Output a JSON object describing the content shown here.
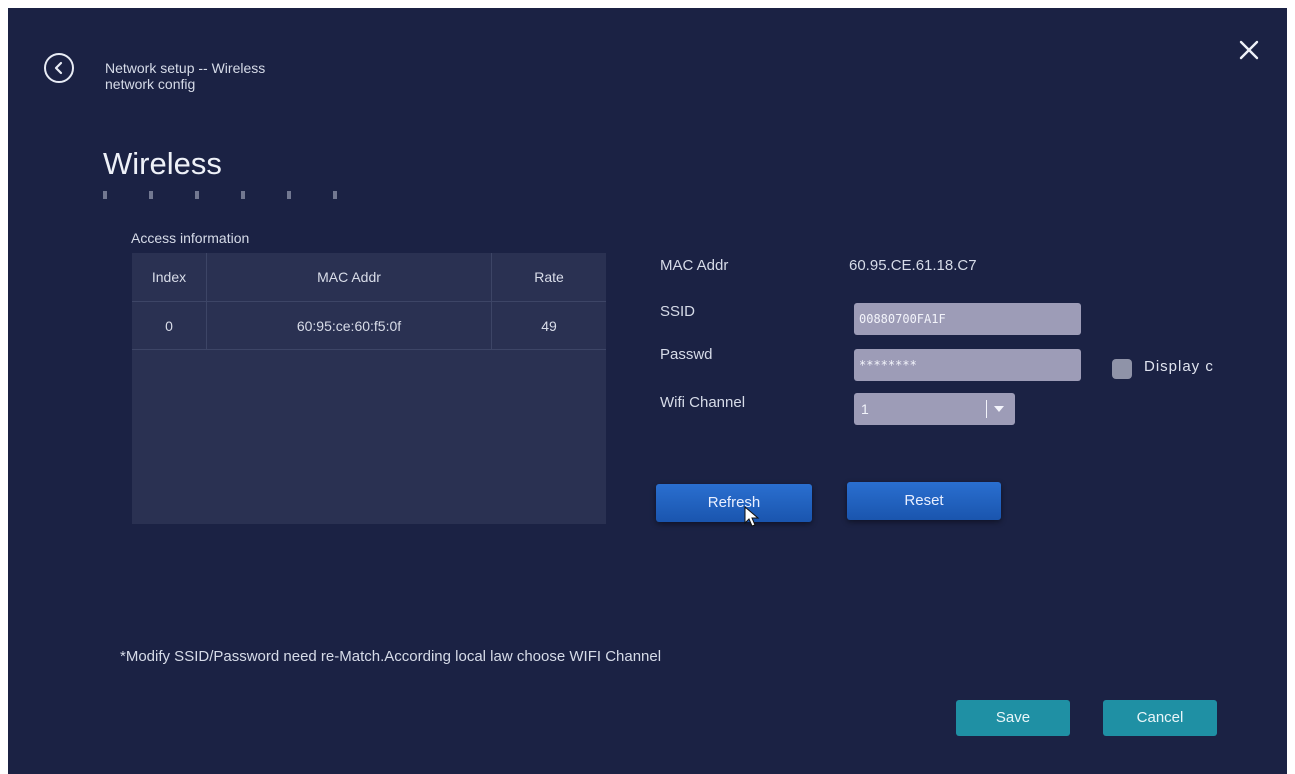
{
  "header": {
    "breadcrumb_line1": "Network setup -- Wireless",
    "breadcrumb_line2": "network config",
    "title": "Wireless"
  },
  "access": {
    "section_label": "Access information",
    "columns": [
      "Index",
      "MAC Addr",
      "Rate"
    ],
    "rows": [
      {
        "index": "0",
        "mac": "60:95:ce:60:f5:0f",
        "rate": "49"
      }
    ]
  },
  "form": {
    "mac_label": "MAC Addr",
    "mac_value": "60.95.CE.61.18.C7",
    "ssid_label": "SSID",
    "ssid_value": "00880700FA1F",
    "passwd_label": "Passwd",
    "passwd_value": "********",
    "display_label": "Display c",
    "channel_label": "Wifi Channel",
    "channel_value": "1"
  },
  "buttons": {
    "refresh": "Refresh",
    "reset": "Reset",
    "save": "Save",
    "cancel": "Cancel"
  },
  "note": "*Modify SSID/Password need re-Match.According local law choose WIFI Channel",
  "colors": {
    "background": "#1b2244",
    "panel": "#2a3152",
    "primary_button": "#1f5fc0",
    "action_button": "#1f90a4",
    "field": "#9d9cb7"
  }
}
